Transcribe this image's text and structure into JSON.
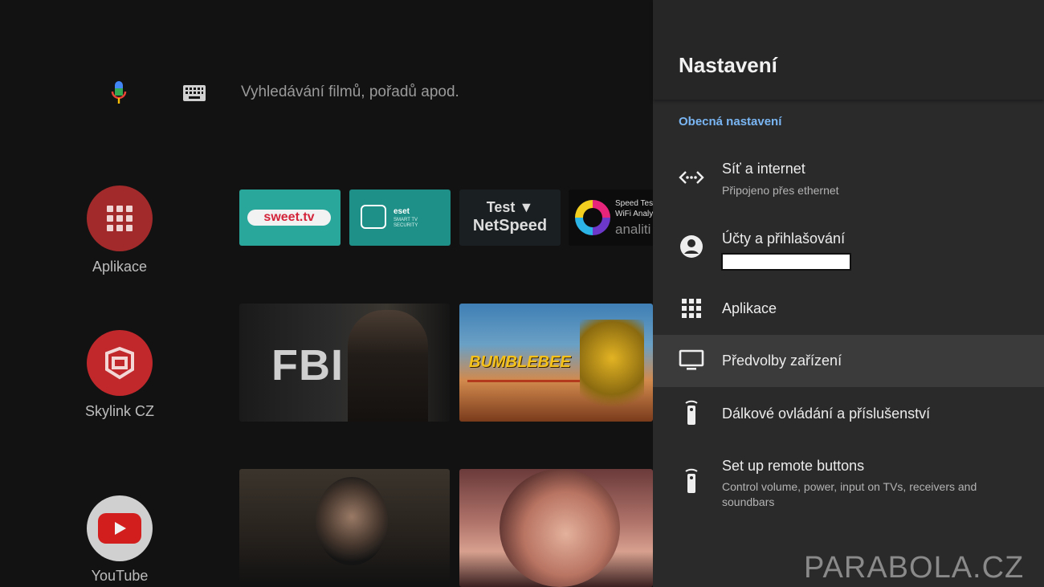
{
  "search": {
    "placeholder": "Vyhledávání filmů, pořadů apod."
  },
  "rows": {
    "apps_label": "Aplikace",
    "skylink_label": "Skylink CZ",
    "youtube_label": "YouTube"
  },
  "apps": {
    "sweet": "sweet.tv",
    "eset_logo": "eset",
    "eset_sub1": "SMART TV",
    "eset_sub2": "SECURITY",
    "test_line1": "Test",
    "test_line2": "NetSpeed",
    "speed_t1": "Speed Tes",
    "speed_t2": "WiFi Analy",
    "speed_t3": "analiti"
  },
  "content": {
    "fbi": "FBI",
    "bumblebee": "BUMBLEBEE"
  },
  "settings": {
    "title": "Nastavení",
    "section": "Obecná nastavení",
    "items": [
      {
        "title": "Síť a internet",
        "subtitle": "Připojeno přes ethernet",
        "icon": "network-icon"
      },
      {
        "title": "Účty a přihlašování",
        "subtitle": "",
        "icon": "account-icon"
      },
      {
        "title": "Aplikace",
        "subtitle": "",
        "icon": "apps-grid-icon"
      },
      {
        "title": "Předvolby zařízení",
        "subtitle": "",
        "icon": "tv-icon",
        "selected": true
      },
      {
        "title": "Dálkové ovládání a příslušenství",
        "subtitle": "",
        "icon": "remote-icon"
      },
      {
        "title": "Set up remote buttons",
        "subtitle": "Control volume, power, input on TVs, receivers and soundbars",
        "icon": "remote-icon"
      }
    ]
  },
  "watermark": "PARABOLA.CZ",
  "colors": {
    "panel_bg": "#2a2a2b",
    "section_accent": "#7ab6f3",
    "selected_row": "#3b3b3c",
    "apps_circle": "#a32a2a",
    "skylink_circle": "#c0282c",
    "youtube_circle": "#d0d0d0"
  }
}
